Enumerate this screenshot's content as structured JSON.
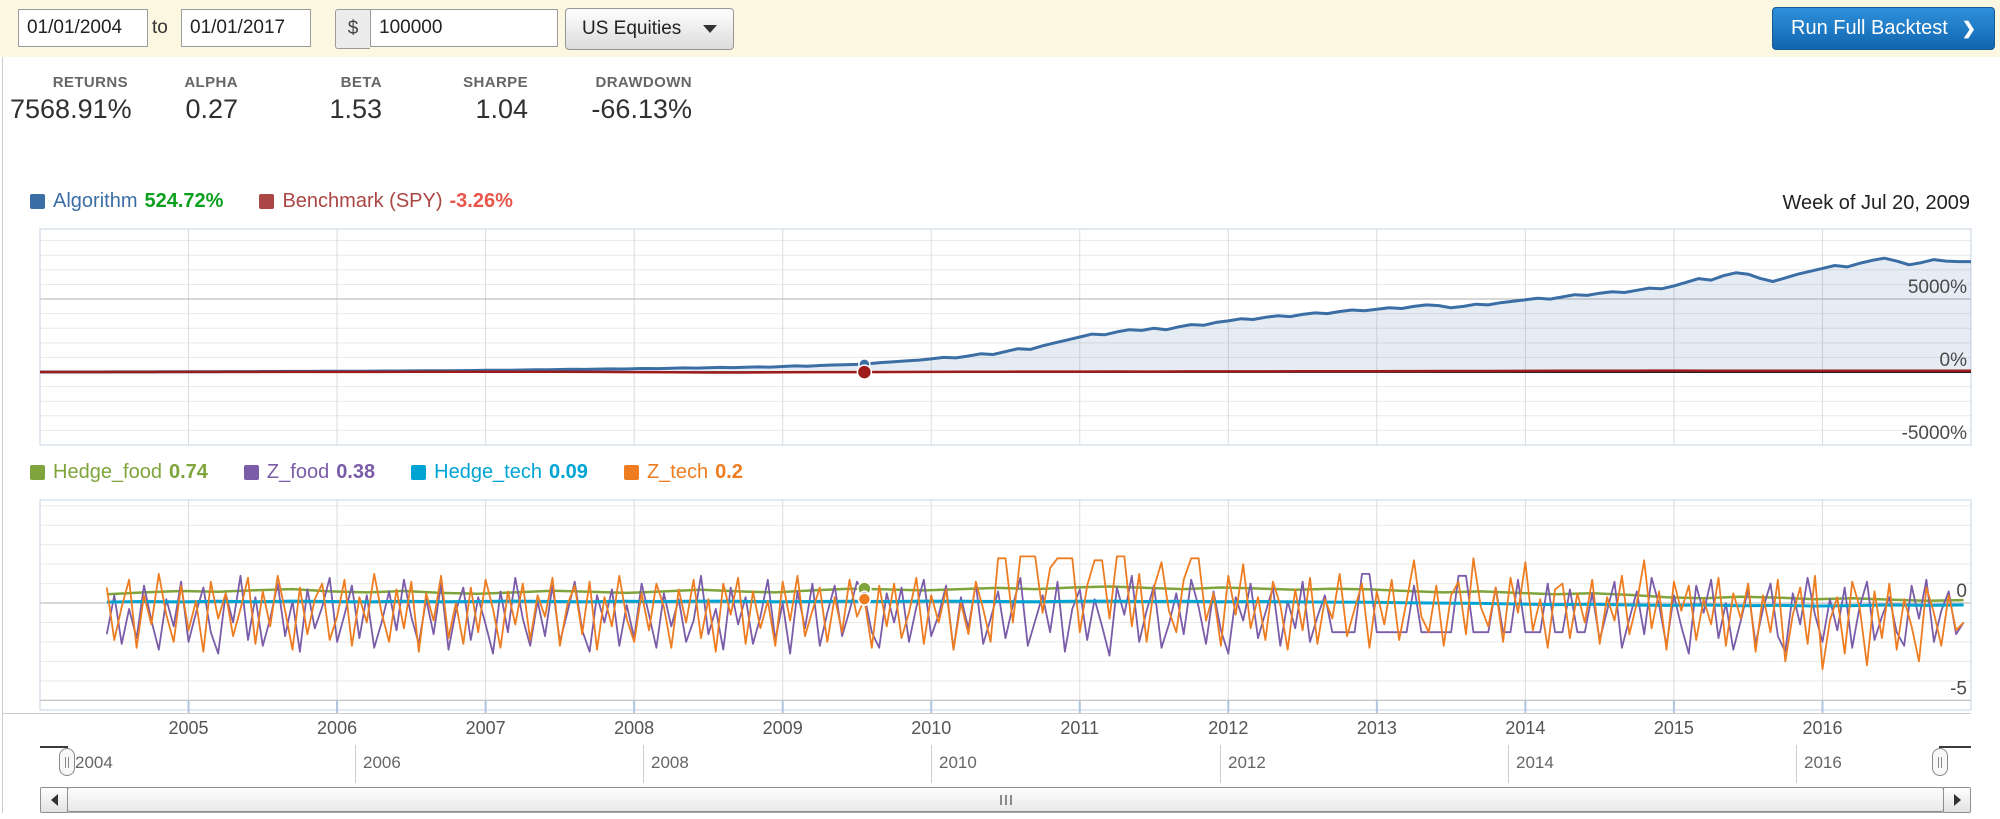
{
  "toolbar": {
    "start_date": "01/01/2004",
    "to_label": "to",
    "end_date": "01/01/2017",
    "currency_symbol": "$",
    "capital": "100000",
    "universe": "US Equities",
    "run_button": "Run Full Backtest",
    "run_chevron": "❯"
  },
  "stats": [
    {
      "label": "RETURNS",
      "value": "7568.91%"
    },
    {
      "label": "ALPHA",
      "value": "0.27"
    },
    {
      "label": "BETA",
      "value": "1.53"
    },
    {
      "label": "SHARPE",
      "value": "1.04"
    },
    {
      "label": "DRAWDOWN",
      "value": "-66.13%"
    }
  ],
  "crosshair_label": "Week of Jul 20, 2009",
  "legend_main": [
    {
      "label": "Algorithm",
      "value": "524.72%",
      "color": "#3B6EA5",
      "value_color": "#0BA01E"
    },
    {
      "label": "Benchmark (SPY)",
      "value": "-3.26%",
      "color": "#AA4643",
      "value_color": "#E8564B"
    }
  ],
  "legend_factors": [
    {
      "label": "Hedge_food",
      "value": "0.74",
      "color": "#7EA43B",
      "value_color": "#7EA43B"
    },
    {
      "label": "Z_food",
      "value": "0.38",
      "color": "#7A5CA8",
      "value_color": "#7A5CA8"
    },
    {
      "label": "Hedge_tech",
      "value": "0.09",
      "color": "#00A4D3",
      "value_color": "#00A4D3"
    },
    {
      "label": "Z_tech",
      "value": "0.2",
      "color": "#EE7D21",
      "value_color": "#EE7D21"
    }
  ],
  "x_axis": {
    "tick_years": [
      2005,
      2006,
      2007,
      2008,
      2009,
      2010,
      2011,
      2012,
      2013,
      2014,
      2015,
      2016
    ]
  },
  "navigator": {
    "year_labels": [
      "2004",
      "2006",
      "2008",
      "2010",
      "2012",
      "2014",
      "2016"
    ],
    "start_year": 2004,
    "end_year": 2017
  },
  "chart_data": [
    {
      "id": "returns",
      "type": "area",
      "title": "Cumulative performance",
      "xlim": [
        2004,
        2017
      ],
      "ylim": [
        -5000,
        9800
      ],
      "grid_step": 1000,
      "ymajor": [
        5000,
        0,
        -5000
      ],
      "zero_axis": true,
      "yticks": [
        {
          "v": 5000,
          "label": "5000%"
        },
        {
          "v": 0,
          "label": "0%"
        },
        {
          "v": -5000,
          "label": "-5000%"
        }
      ],
      "series": [
        {
          "name": "Algorithm",
          "color": "#3B6EA5",
          "fill": "rgba(59,110,165,0.13)",
          "width": 3,
          "x0": 2004,
          "dx": 0.0833333,
          "values": [
            0,
            1,
            3,
            2,
            5,
            4,
            7,
            9,
            8,
            11,
            13,
            15,
            18,
            22,
            20,
            26,
            30,
            28,
            34,
            38,
            42,
            40,
            46,
            50,
            55,
            60,
            58,
            66,
            72,
            70,
            78,
            85,
            82,
            90,
            97,
            105,
            115,
            128,
            122,
            140,
            155,
            150,
            170,
            185,
            178,
            200,
            215,
            208,
            225,
            245,
            238,
            260,
            280,
            270,
            295,
            315,
            305,
            330,
            350,
            340,
            380,
            420,
            400,
            450,
            480,
            500,
            524,
            580,
            650,
            700,
            760,
            820,
            900,
            1000,
            970,
            1100,
            1250,
            1200,
            1400,
            1600,
            1550,
            1800,
            2000,
            2200,
            2400,
            2600,
            2550,
            2750,
            2900,
            2850,
            3000,
            2900,
            3100,
            3250,
            3200,
            3400,
            3500,
            3650,
            3600,
            3750,
            3850,
            3800,
            3950,
            4050,
            4000,
            4150,
            4250,
            4200,
            4300,
            4400,
            4350,
            4500,
            4600,
            4550,
            4400,
            4500,
            4650,
            4600,
            4750,
            4850,
            4950,
            5050,
            5000,
            5150,
            5300,
            5250,
            5400,
            5500,
            5450,
            5600,
            5750,
            5700,
            5900,
            6150,
            6400,
            6300,
            6600,
            6800,
            6700,
            6400,
            6200,
            6450,
            6700,
            6900,
            7100,
            7300,
            7200,
            7450,
            7650,
            7800,
            7600,
            7350,
            7500,
            7700,
            7600,
            7569,
            7569
          ]
        },
        {
          "name": "Benchmark (SPY)",
          "color": "#9E1B1B",
          "width": 2.5,
          "x0": 2004,
          "dx": 0.25,
          "values": [
            0,
            2,
            4,
            3,
            6,
            8,
            7,
            9,
            11,
            10,
            13,
            15,
            14,
            17,
            15,
            10,
            -5,
            -20,
            -35,
            -30,
            -15,
            -8,
            -3,
            5,
            12,
            18,
            25,
            30,
            28,
            35,
            32,
            40,
            46,
            44,
            52,
            58,
            56,
            66,
            72,
            70,
            78,
            85,
            82,
            90,
            95,
            92,
            88,
            94,
            90,
            85,
            88,
            86,
            84
          ]
        }
      ],
      "marker": {
        "x": 2009.55,
        "points": [
          {
            "series": 0,
            "v": 524.72,
            "r": 5.5
          },
          {
            "series": 1,
            "v": -3.26,
            "r": 7
          }
        ]
      }
    },
    {
      "id": "factors",
      "type": "line",
      "title": "Factors",
      "xlim": [
        2004,
        2017
      ],
      "ylim": [
        -5.5,
        5.3
      ],
      "grid_step": 1,
      "ymajor": [
        0,
        -5
      ],
      "zero_axis": false,
      "yticks": [
        {
          "v": 0,
          "label": "0"
        },
        {
          "v": -5,
          "label": "-5"
        }
      ],
      "series": [
        {
          "name": "Hedge_food",
          "color": "#7EA43B",
          "width": 2.5,
          "x0": 2004.45,
          "dx": 0.25,
          "values": [
            0.45,
            0.55,
            0.62,
            0.58,
            0.66,
            0.72,
            0.6,
            0.55,
            0.62,
            0.52,
            0.48,
            0.55,
            0.63,
            0.58,
            0.52,
            0.6,
            0.68,
            0.6,
            0.55,
            0.65,
            0.74,
            0.7,
            0.65,
            0.72,
            0.78,
            0.72,
            0.8,
            0.85,
            0.78,
            0.72,
            0.8,
            0.75,
            0.68,
            0.74,
            0.7,
            0.62,
            0.55,
            0.6,
            0.52,
            0.45,
            0.5,
            0.42,
            0.3,
            0.25,
            0.32,
            0.28,
            0.2,
            0.25,
            0.18,
            0.12,
            0.15
          ]
        },
        {
          "name": "Z_food",
          "color": "#7A5CA8",
          "width": 1.8,
          "x0": 2004.45,
          "dx": 0.05,
          "values": [
            -1.6,
            0.4,
            -2.1,
            -0.3,
            -1.8,
            0.9,
            -0.9,
            -2.4,
            0.2,
            -1.2,
            1.1,
            -2.0,
            -0.5,
            0.8,
            -1.5,
            -2.6,
            0.5,
            -1.0,
            1.4,
            -1.9,
            0.3,
            -2.2,
            -0.8,
            1.0,
            -1.7,
            0.1,
            -2.5,
            0.7,
            -1.3,
            -0.2,
            1.3,
            -2.0,
            -0.6,
            0.9,
            -1.8,
            0.4,
            -2.3,
            -1.0,
            0.6,
            -1.4,
            1.2,
            -0.7,
            -2.1,
            0.2,
            -1.6,
            1.0,
            -2.4,
            -0.4,
            0.8,
            -1.9,
            0.3,
            -1.1,
            -2.6,
            0.6,
            -1.5,
            1.3,
            -0.8,
            -2.2,
            0.1,
            -1.7,
            0.9,
            -2.0,
            -0.5,
            1.1,
            -1.4,
            -2.5,
            0.4,
            -1.0,
            0.7,
            -2.2,
            -0.1,
            -1.8,
            1.0,
            -0.6,
            -2.3,
            0.5,
            -1.2,
            0.2,
            -2.0,
            -0.9,
            1.4,
            -1.6,
            -0.3,
            -2.4,
            0.8,
            -1.1,
            0.3,
            -2.1,
            -0.7,
            1.2,
            -1.9,
            0.0,
            -2.6,
            0.6,
            -1.3,
            1.0,
            -2.2,
            -0.5,
            0.9,
            -1.7,
            -0.4,
            1.1,
            0.38,
            -1.5,
            -2.3,
            0.5,
            -1.0,
            0.8,
            -2.0,
            -0.2,
            1.2,
            -1.7,
            -0.6,
            0.9,
            -2.4,
            0.3,
            -1.3,
            1.0,
            -2.1,
            -0.8,
            0.6,
            -1.8,
            -0.1,
            1.3,
            -2.2,
            -0.9,
            0.4,
            -1.5,
            1.1,
            -2.5,
            -0.3,
            0.7,
            -1.9,
            0.2,
            -1.2,
            -2.7,
            0.8,
            -0.6,
            1.4,
            -2.0,
            -0.4,
            0.9,
            -2.3,
            -1.1,
            0.5,
            -1.6,
            1.2,
            -0.2,
            -2.1,
            0.6,
            -1.4,
            -2.6,
            0.3,
            -0.9,
            1.0,
            -1.8,
            -0.5,
            0.8,
            -2.2,
            0.1,
            -1.3,
            1.1,
            -2.0,
            -0.7,
            0.4,
            -1.5,
            -1.5,
            -1.5,
            -1.5,
            1.5,
            1.5,
            -1.5,
            -1.5,
            -1.5,
            -1.5,
            -1.5,
            0.9,
            -1.5,
            -1.5,
            -1.5,
            -1.5,
            -1.5,
            1.4,
            1.4,
            -1.5,
            -1.5,
            -1.5,
            0.8,
            -1.5,
            -1.5,
            1.2,
            -1.5,
            -1.5,
            -1.5,
            1.0,
            -1.5,
            -1.5,
            0.7,
            -1.5,
            -1.5,
            0.5,
            -1.9,
            -0.4,
            1.1,
            -2.3,
            -0.8,
            0.6,
            -1.6,
            1.3,
            -0.1,
            -2.2,
            0.4,
            -1.2,
            -2.6,
            0.9,
            -0.5,
            1.2,
            -1.8,
            0.0,
            -2.4,
            -0.9,
            0.7,
            -2.1,
            -0.3,
            1.0,
            -1.7,
            -2.5,
            0.5,
            -1.1,
            1.3,
            -0.6,
            -2.0,
            0.2,
            -1.4,
            0.8,
            -2.3,
            -0.2,
            1.1,
            -1.9,
            -0.7,
            0.3,
            -1.5,
            -2.2,
            0.9,
            -0.8,
            1.2,
            -2.0,
            -0.4,
            0.6,
            -1.6,
            -1.0
          ]
        },
        {
          "name": "Hedge_tech",
          "color": "#00A4D3",
          "width": 3,
          "x0": 2004.45,
          "dx": 0.25,
          "values": [
            0.05,
            0.08,
            0.06,
            0.09,
            0.07,
            0.1,
            0.08,
            0.06,
            0.09,
            0.07,
            0.08,
            0.1,
            0.08,
            0.07,
            0.09,
            0.08,
            0.1,
            0.09,
            0.07,
            0.08,
            0.09,
            0.08,
            0.1,
            0.09,
            0.08,
            0.07,
            0.09,
            0.1,
            0.08,
            0.09,
            0.07,
            0.08,
            0.06,
            0.05,
            0.04,
            0.02,
            0.0,
            -0.02,
            -0.05,
            -0.08,
            -0.06,
            -0.1,
            -0.12,
            -0.1,
            -0.14,
            -0.12,
            -0.15,
            -0.13,
            -0.1,
            -0.12,
            -0.1
          ]
        },
        {
          "name": "Z_tech",
          "color": "#EE7D21",
          "width": 1.8,
          "x0": 2004.45,
          "dx": 0.05,
          "values": [
            0.8,
            -1.9,
            -0.2,
            1.2,
            -2.3,
            0.4,
            -1.1,
            1.5,
            -0.6,
            -2.0,
            0.9,
            -1.4,
            0.1,
            -2.5,
            1.1,
            -0.8,
            0.5,
            -1.7,
            -0.3,
            1.3,
            -2.1,
            0.6,
            -1.2,
            1.4,
            -0.4,
            -2.4,
            0.8,
            -1.6,
            0.2,
            1.0,
            -1.9,
            -0.7,
            1.2,
            -2.2,
            0.3,
            -1.0,
            1.5,
            -0.5,
            -2.0,
            0.7,
            -1.3,
            1.1,
            -2.5,
            0.5,
            -0.9,
            1.4,
            -1.8,
            0.0,
            -2.1,
            0.8,
            -1.5,
            1.2,
            -0.3,
            -2.3,
            0.6,
            -1.1,
            1.0,
            -1.9,
            0.4,
            -0.7,
            1.3,
            -2.2,
            -0.1,
            0.9,
            -1.6,
            1.1,
            -2.4,
            0.3,
            -1.2,
            1.4,
            -0.8,
            -2.0,
            0.5,
            -1.4,
            1.0,
            -0.2,
            -2.3,
            0.7,
            -1.0,
            1.2,
            -1.8,
            0.2,
            -2.5,
            1.0,
            -0.6,
            1.3,
            -2.1,
            0.6,
            -1.3,
            0.1,
            -2.2,
            1.1,
            -0.9,
            1.4,
            -1.7,
            -0.4,
            0.8,
            -2.0,
            0.3,
            -1.5,
            1.2,
            -0.7,
            0.2,
            -2.3,
            0.9,
            -1.2,
            1.0,
            -1.8,
            -0.5,
            1.3,
            -2.1,
            0.4,
            -1.0,
            0.7,
            -2.4,
            0.0,
            -1.6,
            1.1,
            -0.3,
            -2.0,
            2.3,
            2.3,
            -1.0,
            2.4,
            2.4,
            2.4,
            -0.5,
            1.8,
            2.3,
            2.3,
            2.3,
            -1.5,
            0.9,
            2.2,
            2.2,
            -0.8,
            2.4,
            2.4,
            -1.2,
            1.5,
            -2.0,
            0.8,
            2.1,
            -0.4,
            -1.5,
            1.2,
            2.3,
            2.3,
            -0.9,
            0.5,
            -2.2,
            1.4,
            -0.6,
            2.0,
            -1.3,
            0.3,
            -1.9,
            1.1,
            -0.1,
            -2.4,
            0.7,
            -1.4,
            1.3,
            -2.1,
            0.2,
            -0.8,
            1.5,
            -1.7,
            -0.3,
            1.0,
            -2.3,
            0.6,
            -1.1,
            1.2,
            -1.9,
            0.1,
            2.2,
            -0.7,
            -1.5,
            0.9,
            -2.2,
            0.4,
            1.1,
            -1.6,
            2.3,
            -0.2,
            -1.2,
            0.8,
            -2.0,
            1.3,
            -0.5,
            2.1,
            -1.4,
            0.2,
            -2.3,
            0.7,
            1.0,
            -1.8,
            0.5,
            -1.0,
            1.2,
            -2.1,
            0.3,
            -0.9,
            1.4,
            -1.6,
            0.0,
            2.2,
            -1.3,
            0.6,
            -2.4,
            1.1,
            -0.4,
            0.9,
            -1.9,
            0.2,
            -1.1,
            1.3,
            -2.2,
            0.5,
            -0.8,
            1.0,
            -2.5,
            0.4,
            -1.5,
            1.2,
            -3.0,
            -0.6,
            0.8,
            -2.1,
            1.4,
            -3.4,
            -0.9,
            0.3,
            -2.6,
            1.1,
            -0.2,
            -3.2,
            0.6,
            -1.8,
            1.0,
            -2.4,
            0.2,
            -1.2,
            -3.0,
            0.8,
            -0.5,
            -2.2,
            0.4,
            -1.4,
            -1.0
          ]
        }
      ],
      "marker": {
        "x": 2009.55,
        "points": [
          {
            "series": 0,
            "v": 0.74,
            "r": 6.5
          },
          {
            "series": 1,
            "v": 0.38,
            "r": 4.5
          },
          {
            "series": 2,
            "v": 0.09,
            "r": 4
          },
          {
            "series": 3,
            "v": 0.2,
            "r": 6
          }
        ]
      }
    }
  ]
}
